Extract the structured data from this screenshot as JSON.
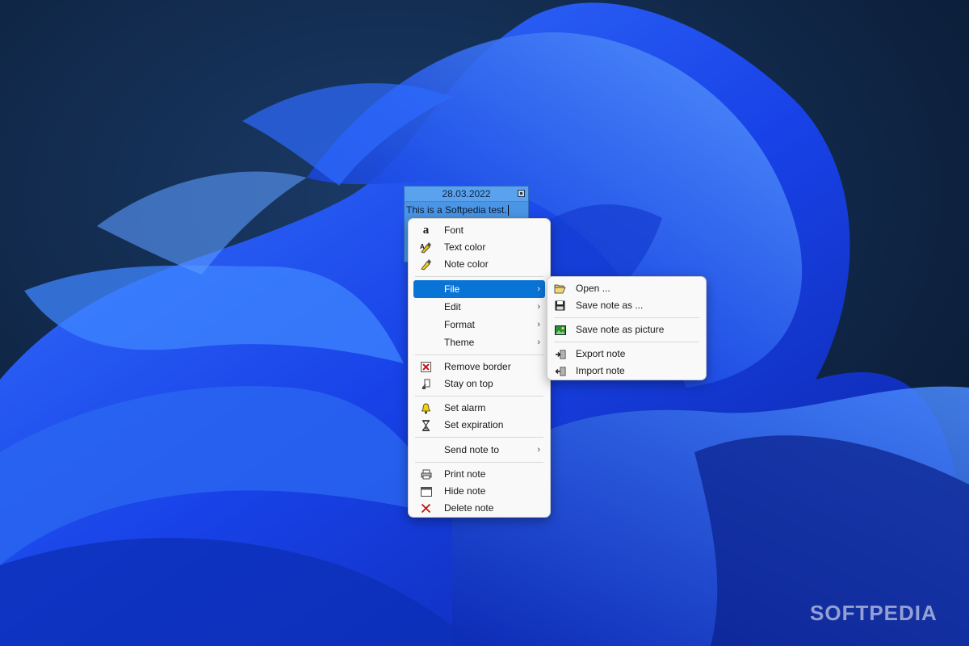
{
  "note": {
    "date": "28.03.2022",
    "text": "This is a Softpedia test."
  },
  "context_menu": {
    "items": [
      {
        "label": "Font",
        "icon": "font-icon"
      },
      {
        "label": "Text color",
        "icon": "text-color-icon"
      },
      {
        "label": "Note color",
        "icon": "note-color-icon"
      },
      {
        "label": "File",
        "icon": "",
        "submenu": true,
        "active": true
      },
      {
        "label": "Edit",
        "icon": "",
        "submenu": true
      },
      {
        "label": "Format",
        "icon": "",
        "submenu": true
      },
      {
        "label": "Theme",
        "icon": "",
        "submenu": true
      },
      {
        "label": "Remove border",
        "icon": "remove-border-icon"
      },
      {
        "label": "Stay on top",
        "icon": "stay-on-top-icon"
      },
      {
        "label": "Set alarm",
        "icon": "bell-icon"
      },
      {
        "label": "Set expiration",
        "icon": "hourglass-icon"
      },
      {
        "label": "Send note to",
        "icon": "",
        "submenu": true
      },
      {
        "label": "Print note",
        "icon": "printer-icon"
      },
      {
        "label": "Hide note",
        "icon": "window-icon"
      },
      {
        "label": "Delete note",
        "icon": "delete-icon"
      }
    ]
  },
  "file_submenu": {
    "items": [
      {
        "label": "Open ...",
        "icon": "folder-open-icon"
      },
      {
        "label": "Save note as ...",
        "icon": "floppy-disk-icon"
      },
      {
        "label": "Save note as picture",
        "icon": "picture-icon"
      },
      {
        "label": "Export note",
        "icon": "export-icon"
      },
      {
        "label": "Import note",
        "icon": "import-icon"
      }
    ]
  },
  "watermark": "SOFTPEDIA",
  "colors": {
    "menu_highlight": "#0a74d6",
    "note_background": "#4a95e6",
    "wallpaper_blue": "#1f4fe0"
  }
}
